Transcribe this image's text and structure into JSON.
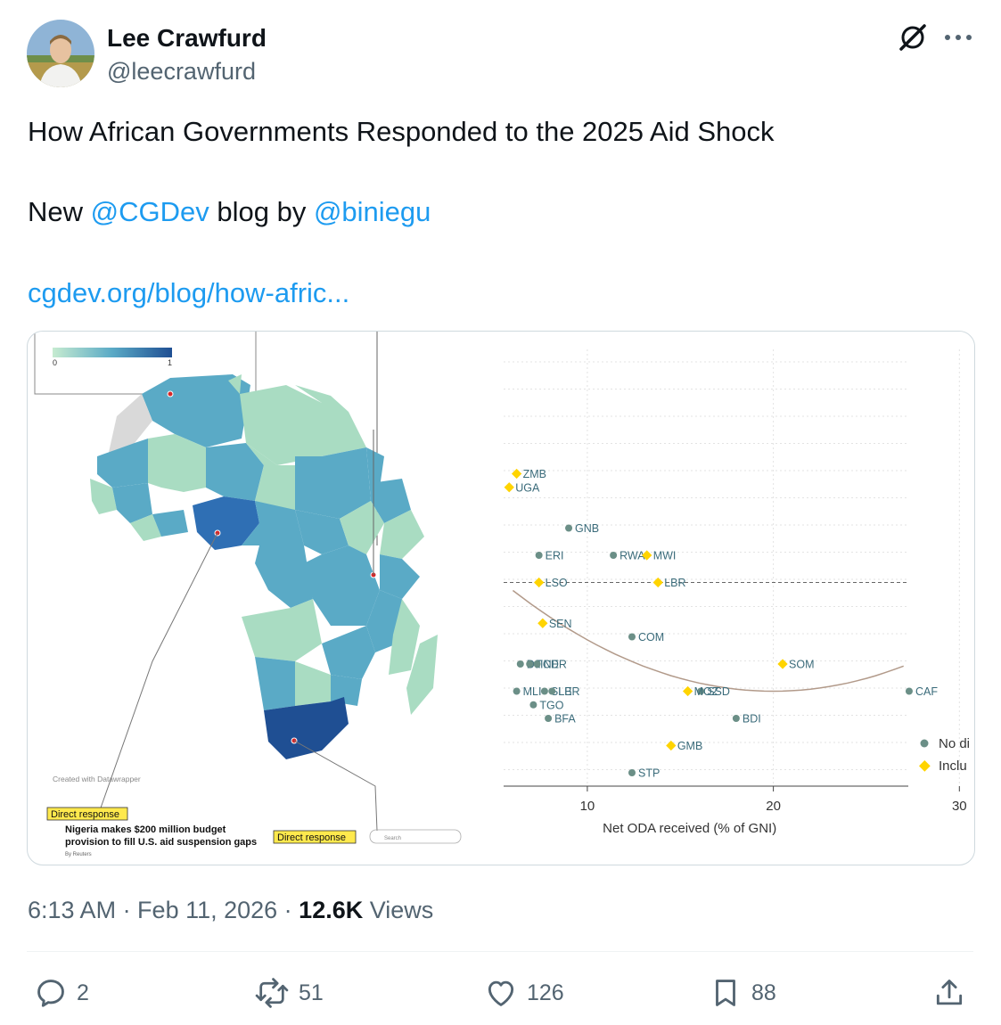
{
  "author": {
    "name": "Lee Crawfurd",
    "handle": "@leecrawfurd"
  },
  "tweet": {
    "line1": "How African Governments Responded to the 2025 Aid Shock",
    "line2_prefix": "New ",
    "mention1": "@CGDev",
    "line2_mid": " blog by ",
    "mention2": "@biniegu",
    "link": "cgdev.org/blog/how-afric..."
  },
  "media": {
    "map": {
      "legend_min": "0",
      "legend_max": "1",
      "credit": "Created with Datawrapper",
      "callout_left": "Direct response",
      "callout_right": "Direct response",
      "headline": "Nigeria makes $200 million budget provision to fill U.S. aid suspension gaps",
      "byline": "By Reuters",
      "search_placeholder": "Search"
    },
    "colors": {
      "map_high": "#2b5797",
      "map_mid": "#5aaac6",
      "map_low": "#a9dcc2",
      "dot_grey": "#6b8f87",
      "diamond_yellow": "#ffd400",
      "callout_yellow": "#ffe94d"
    }
  },
  "chart_data": {
    "type": "scatter",
    "xlabel": "Net ODA received (% of GNI)",
    "ylabel": "",
    "xlim": [
      5.5,
      30.8
    ],
    "x_ticks": [
      10,
      20,
      30
    ],
    "grid": true,
    "legend_position": "right",
    "series": [
      {
        "name": "No di",
        "marker": "circle",
        "points": [
          {
            "label": "GNB",
            "x": 9.0,
            "y": 9.0
          },
          {
            "label": "CAF",
            "x": 27.3,
            "y": 3.0
          },
          {
            "label": "BDI",
            "x": 18.0,
            "y": 2.0
          },
          {
            "label": "STP",
            "x": 12.4,
            "y": 0.0
          },
          {
            "label": "RWA",
            "x": 11.4,
            "y": 8.0
          },
          {
            "label": "COM",
            "x": 12.4,
            "y": 5.0
          },
          {
            "label": "BFA",
            "x": 7.9,
            "y": 2.0
          },
          {
            "label": "TGO",
            "x": 7.1,
            "y": 2.5
          },
          {
            "label": "MLI",
            "x": 6.2,
            "y": 3.0
          },
          {
            "label": "DJI",
            "x": 6.4,
            "y": 4.0
          },
          {
            "label": "TCD",
            "x": 6.9,
            "y": 4.0
          },
          {
            "label": "NER",
            "x": 7.3,
            "y": 4.0
          },
          {
            "label": "SLE",
            "x": 7.7,
            "y": 3.0
          },
          {
            "label": "LBR",
            "x": 8.1,
            "y": 3.0
          },
          {
            "label": "ERI",
            "x": 7.4,
            "y": 8.0
          },
          {
            "label": "SSD",
            "x": 16.1,
            "y": 3.0
          }
        ]
      },
      {
        "name": "Inclu",
        "marker": "diamond",
        "points": [
          {
            "label": "ZMB",
            "x": 6.2,
            "y": 11.0
          },
          {
            "label": "UGA",
            "x": 5.8,
            "y": 10.5
          },
          {
            "label": "MWI",
            "x": 13.2,
            "y": 8.0
          },
          {
            "label": "LBR",
            "x": 13.8,
            "y": 7.0
          },
          {
            "label": "LSO",
            "x": 7.4,
            "y": 7.0
          },
          {
            "label": "SEN",
            "x": 7.6,
            "y": 5.5
          },
          {
            "label": "SOM",
            "x": 20.5,
            "y": 4.0
          },
          {
            "label": "MOZ",
            "x": 15.4,
            "y": 3.0
          },
          {
            "label": "GMB",
            "x": 14.5,
            "y": 1.0
          }
        ]
      }
    ],
    "fit_curve": "quadratic",
    "reference_line": "dashed horizontal"
  },
  "footer": {
    "time": "6:13 AM · Feb 11, 2026 · ",
    "views_count": "12.6K",
    "views_label": " Views"
  },
  "actions": {
    "replies": "2",
    "reposts": "51",
    "likes": "126",
    "bookmarks": "88"
  }
}
